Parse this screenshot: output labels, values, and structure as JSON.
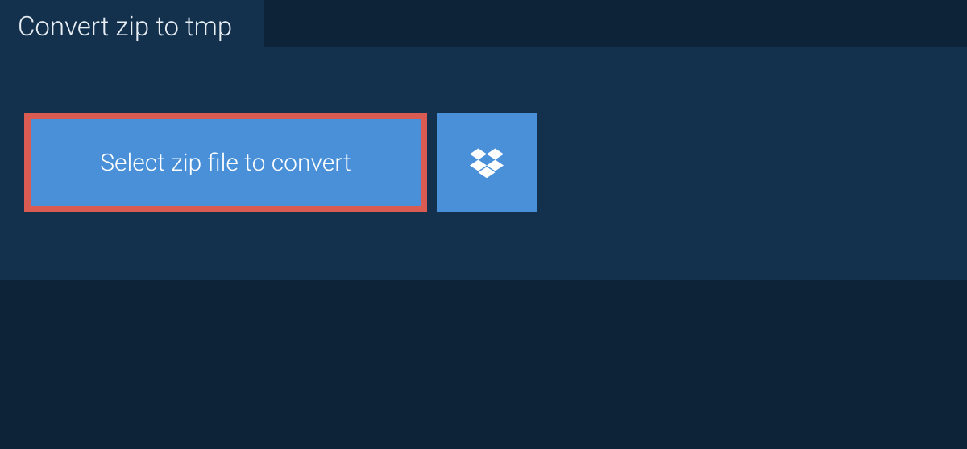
{
  "tab": {
    "title": "Convert zip to tmp"
  },
  "actions": {
    "select_file_label": "Select zip file to convert"
  },
  "colors": {
    "background": "#0d2438",
    "panel": "#13314d",
    "button": "#4a90d9",
    "highlight_border": "#d95b52"
  }
}
